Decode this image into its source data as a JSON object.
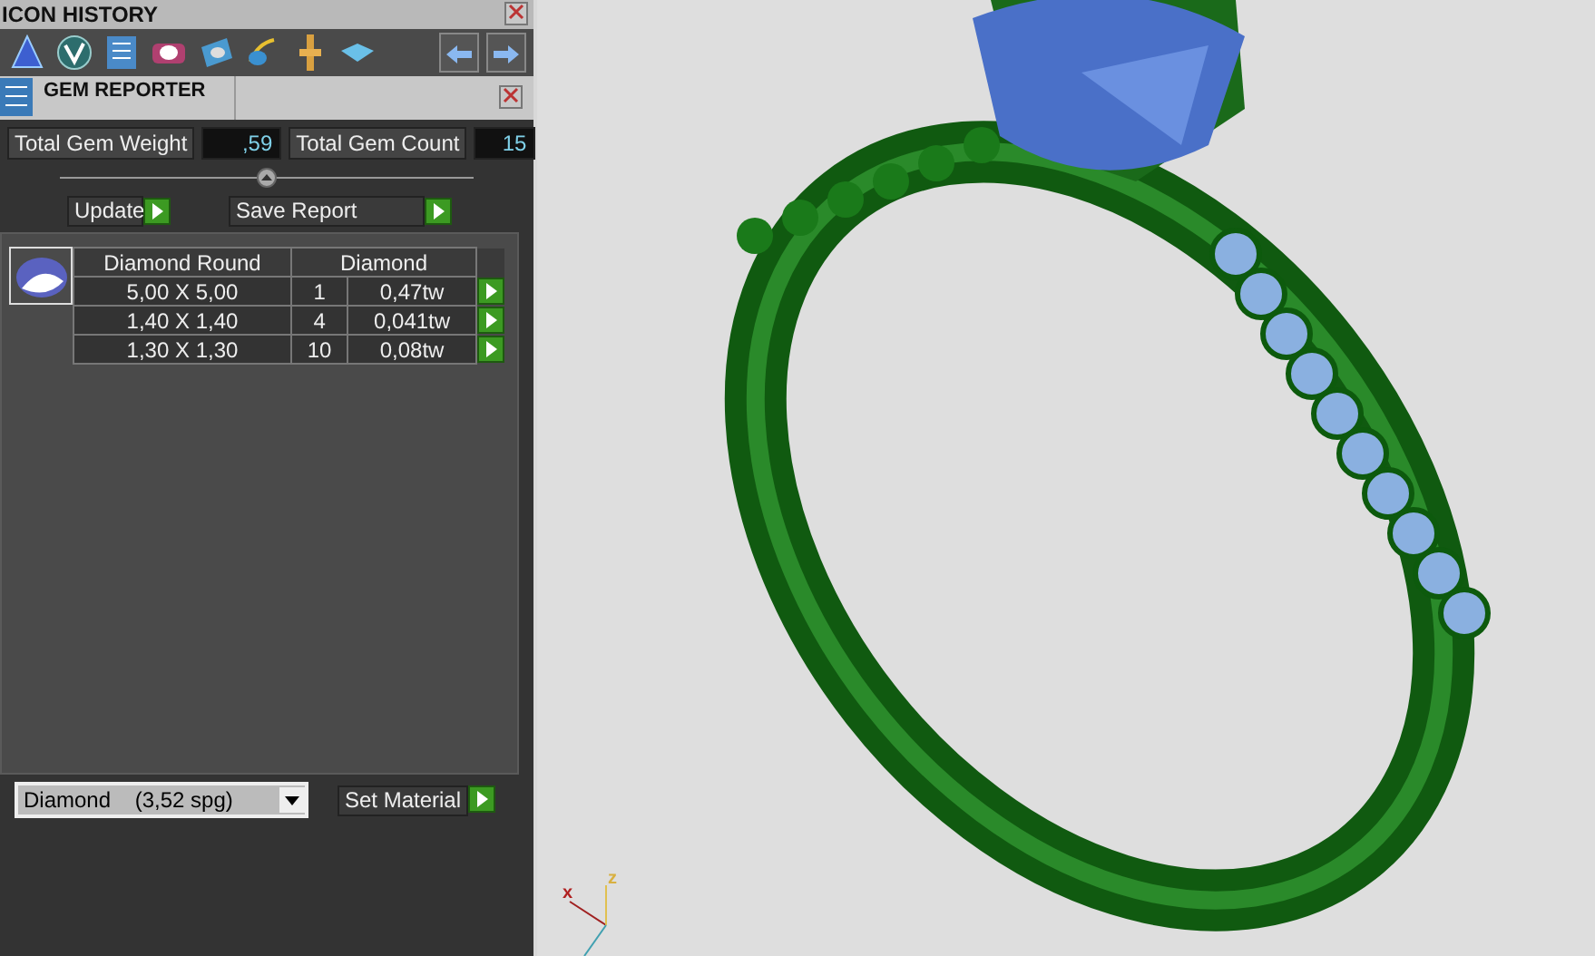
{
  "icon_history": {
    "title": "ICON HISTORY"
  },
  "gem_reporter": {
    "title": "GEM REPORTER",
    "stats": [
      {
        "label": "Total Gem Weight",
        "value": ",59"
      },
      {
        "label": "Total Gem Count",
        "value": "15"
      }
    ],
    "buttons": [
      "Update",
      "Save Report"
    ],
    "table": {
      "columns": [
        "Diamond Round",
        "Diamond"
      ],
      "rows": [
        {
          "size": "5,00 X 5,00",
          "count": "1",
          "weight": "0,47tw"
        },
        {
          "size": "1,40 X 1,40",
          "count": "4",
          "weight": "0,041tw"
        },
        {
          "size": "1,30 X 1,30",
          "count": "10",
          "weight": "0,08tw"
        }
      ]
    },
    "material": {
      "value": "Diamond    (3,52 spg)",
      "button": "Set Material"
    }
  },
  "viewport": {
    "axes": [
      "x",
      "z"
    ]
  }
}
